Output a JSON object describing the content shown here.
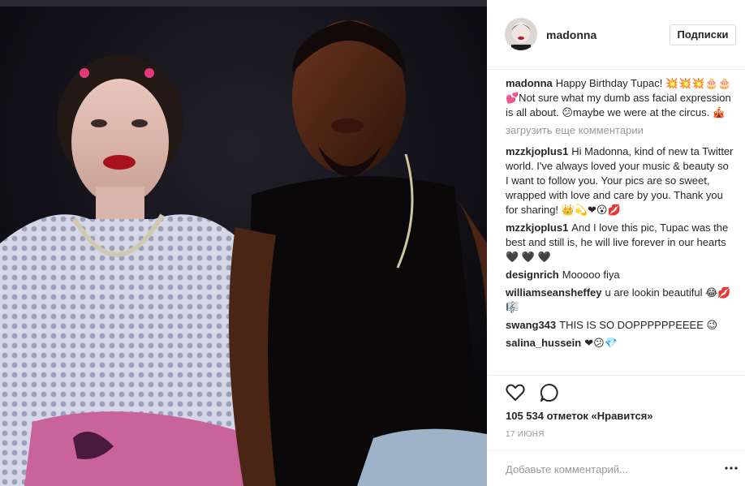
{
  "post": {
    "username": "madonna",
    "follow_label": "Подписки",
    "load_more": "загрузить еще комментарии",
    "likes": "105 534 отметок «Нравится»",
    "date": "17 ИЮНЯ",
    "add_comment_placeholder": "Добавьте комментарий..."
  },
  "comments": [
    {
      "author": "madonna",
      "text": "Happy Birthday Tupac! 💥💥💥🎂🎂💕Not sure what my dumb ass facial expression is all about. 😕maybe we were at the circus. 🎪"
    },
    {
      "author": "mzzkjoplus1",
      "text": "Hi Madonna, kind of new ta Twitter world. I've always loved your music & beauty so I want to follow you. Your pics are so sweet, wrapped with love and care by you. Thank you for sharing! 👑💫❤😮💋"
    },
    {
      "author": "mzzkjoplus1",
      "text": "And I love this pic, Tupac was the best and still is, he will live forever in our hearts 🖤 🖤 🖤"
    },
    {
      "author": "designrich",
      "text": "Mooooo fiya"
    },
    {
      "author": "williamseansheffey",
      "text": "u are lookin beautiful 😂💋🎼"
    },
    {
      "author": "swang343",
      "text": "THIS IS SO DOPPPPPPEEEE 😉"
    },
    {
      "author": "salina_hussein",
      "text": "❤😕💎"
    }
  ],
  "icons": {
    "like": "heart-outline-icon",
    "comment": "speech-bubble-icon",
    "more": "more-horizontal-icon"
  },
  "colors": {
    "text": "#262626",
    "muted": "#999999",
    "border": "#efefef"
  }
}
